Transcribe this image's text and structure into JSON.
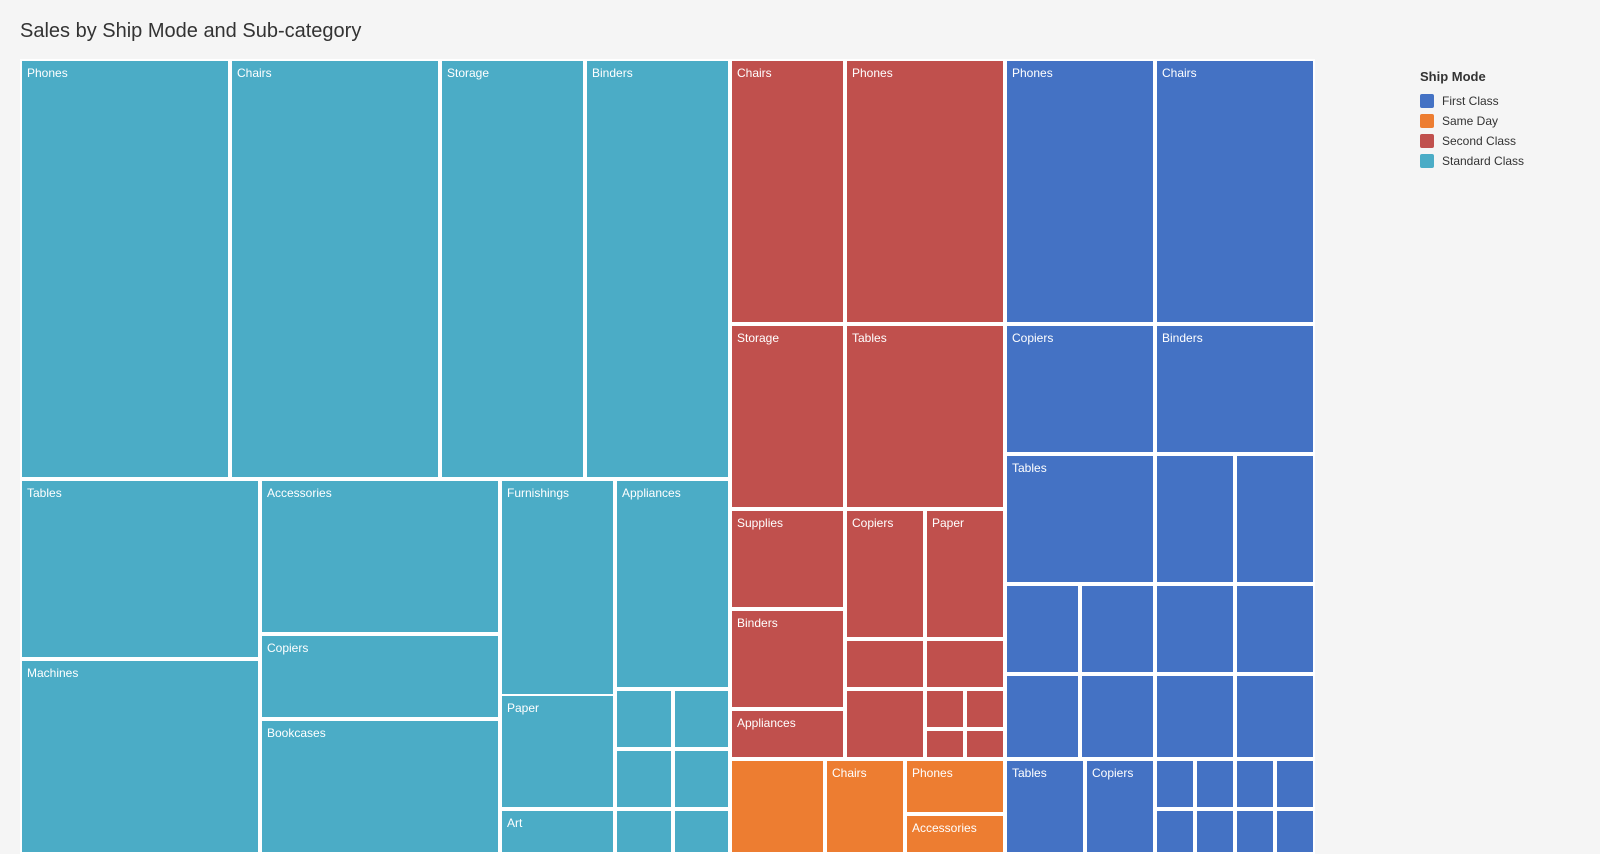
{
  "title": "Sales by Ship Mode and Sub-category",
  "legend": {
    "title": "Ship Mode",
    "items": [
      {
        "label": "First Class",
        "color": "#4472C4"
      },
      {
        "label": "Same Day",
        "color": "#ED7D31"
      },
      {
        "label": "Second Class",
        "color": "#C0504D"
      },
      {
        "label": "Standard Class",
        "color": "#4BACC6"
      }
    ]
  },
  "colors": {
    "standard": "#4BACC6",
    "second": "#C0504D",
    "first": "#4472C4",
    "sameday": "#ED7D31"
  }
}
